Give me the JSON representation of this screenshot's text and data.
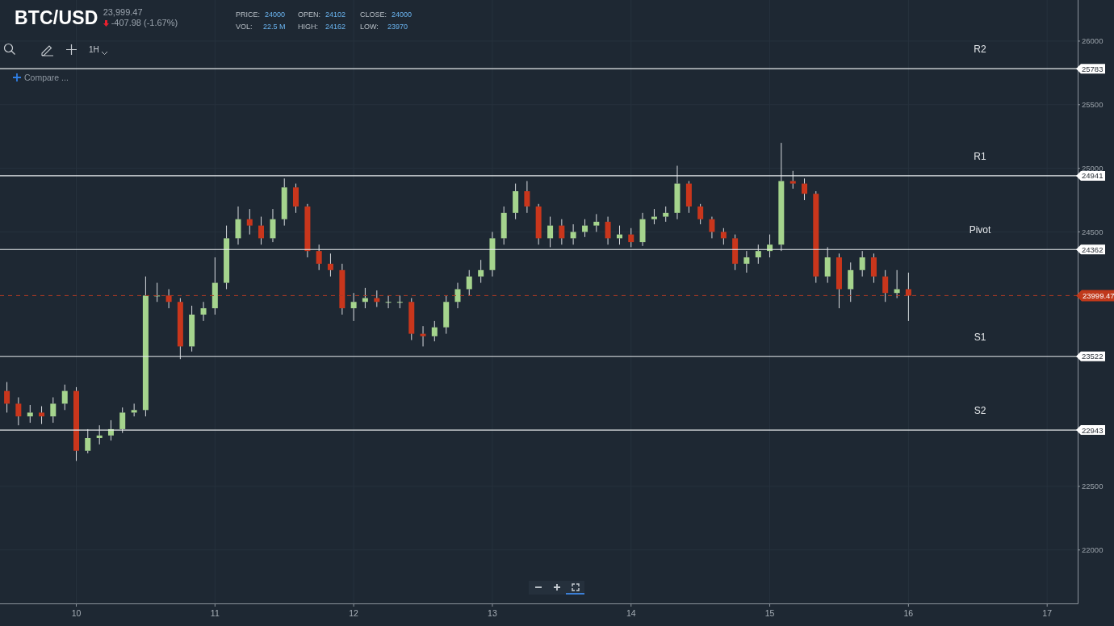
{
  "symbol": "BTC/USD",
  "quote": {
    "price": "23,999.47",
    "change": "-407.98 (-1.67%)",
    "down": true
  },
  "stats": [
    {
      "label": "PRICE:",
      "value": "24000"
    },
    {
      "label": "VOL:",
      "value": "22.5 M"
    },
    {
      "label": "OPEN:",
      "value": "24102"
    },
    {
      "label": "HIGH:",
      "value": "24162"
    },
    {
      "label": "CLOSE:",
      "value": "24000"
    },
    {
      "label": "LOW:",
      "value": "23970"
    }
  ],
  "toolbar": {
    "interval": "1H"
  },
  "compare": {
    "label": "Compare ..."
  },
  "levels": [
    {
      "label": "R2",
      "value": "25783"
    },
    {
      "label": "R1",
      "value": "24941"
    },
    {
      "label": "Pivot",
      "value": "24362"
    },
    {
      "label": "S1",
      "value": "23522"
    },
    {
      "label": "S2",
      "value": "22943"
    }
  ],
  "chart_data": {
    "type": "candlestick",
    "grid": true,
    "xlim": [
      9.45,
      17.22
    ],
    "ylim": [
      21580,
      26323
    ],
    "xticks": [
      10,
      11,
      12,
      13,
      14,
      15,
      16,
      17
    ],
    "yticks": [
      22000,
      22500,
      24500,
      25000,
      25500,
      26000
    ],
    "ref_lines": [
      {
        "axis": "y",
        "value": 23999.47,
        "label": "23999.47",
        "color": "#b03a24"
      }
    ],
    "x": [
      9.5,
      9.583,
      9.667,
      9.75,
      9.833,
      9.917,
      10,
      10.083,
      10.167,
      10.25,
      10.333,
      10.417,
      10.5,
      10.583,
      10.667,
      10.75,
      10.833,
      10.917,
      11,
      11.083,
      11.167,
      11.25,
      11.333,
      11.417,
      11.5,
      11.583,
      11.667,
      11.75,
      11.833,
      11.917,
      12,
      12.083,
      12.167,
      12.25,
      12.333,
      12.417,
      12.5,
      12.583,
      12.667,
      12.75,
      12.833,
      12.917,
      13,
      13.083,
      13.167,
      13.25,
      13.333,
      13.417,
      13.5,
      13.583,
      13.667,
      13.75,
      13.833,
      13.917,
      14,
      14.083,
      14.167,
      14.25,
      14.333,
      14.417,
      14.5,
      14.583,
      14.667,
      14.75,
      14.833,
      14.917,
      15,
      15.083,
      15.167,
      15.25,
      15.333,
      15.417,
      15.5,
      15.583,
      15.667,
      15.75,
      15.833,
      15.917,
      16
    ],
    "ohlc": [
      [
        23250,
        23320,
        23080,
        23150
      ],
      [
        23150,
        23200,
        22980,
        23050
      ],
      [
        23050,
        23140,
        23000,
        23080
      ],
      [
        23080,
        23130,
        22990,
        23050
      ],
      [
        23050,
        23200,
        23000,
        23150
      ],
      [
        23150,
        23300,
        23100,
        23250
      ],
      [
        23250,
        23280,
        22700,
        22780
      ],
      [
        22780,
        22950,
        22760,
        22880
      ],
      [
        22880,
        22980,
        22830,
        22900
      ],
      [
        22900,
        23020,
        22860,
        22950
      ],
      [
        22950,
        23120,
        22920,
        23080
      ],
      [
        23080,
        23150,
        23050,
        23100
      ],
      [
        23100,
        24150,
        23050,
        24000
      ],
      [
        24000,
        24100,
        23950,
        24000
      ],
      [
        24000,
        24050,
        23900,
        23950
      ],
      [
        23950,
        23980,
        23500,
        23600
      ],
      [
        23600,
        23920,
        23560,
        23850
      ],
      [
        23850,
        23950,
        23800,
        23900
      ],
      [
        23900,
        24300,
        23850,
        24100
      ],
      [
        24100,
        24550,
        24050,
        24450
      ],
      [
        24450,
        24700,
        24400,
        24600
      ],
      [
        24600,
        24680,
        24480,
        24550
      ],
      [
        24550,
        24620,
        24400,
        24450
      ],
      [
        24450,
        24680,
        24420,
        24600
      ],
      [
        24600,
        24920,
        24550,
        24850
      ],
      [
        24850,
        24880,
        24650,
        24700
      ],
      [
        24700,
        24720,
        24300,
        24350
      ],
      [
        24350,
        24400,
        24200,
        24250
      ],
      [
        24250,
        24330,
        24150,
        24200
      ],
      [
        24200,
        24250,
        23850,
        23900
      ],
      [
        23900,
        24020,
        23800,
        23950
      ],
      [
        23950,
        24060,
        23900,
        23980
      ],
      [
        23980,
        24040,
        23910,
        23950
      ],
      [
        23950,
        24000,
        23900,
        23950
      ],
      [
        23950,
        24000,
        23900,
        23950
      ],
      [
        23950,
        23980,
        23650,
        23700
      ],
      [
        23700,
        23760,
        23600,
        23680
      ],
      [
        23680,
        23800,
        23640,
        23750
      ],
      [
        23750,
        24000,
        23700,
        23950
      ],
      [
        23950,
        24100,
        23900,
        24050
      ],
      [
        24050,
        24200,
        24000,
        24150
      ],
      [
        24150,
        24280,
        24100,
        24200
      ],
      [
        24200,
        24500,
        24150,
        24450
      ],
      [
        24450,
        24700,
        24400,
        24650
      ],
      [
        24650,
        24880,
        24600,
        24820
      ],
      [
        24820,
        24900,
        24650,
        24700
      ],
      [
        24700,
        24720,
        24400,
        24450
      ],
      [
        24450,
        24620,
        24380,
        24550
      ],
      [
        24550,
        24600,
        24400,
        24450
      ],
      [
        24450,
        24560,
        24400,
        24500
      ],
      [
        24500,
        24600,
        24460,
        24550
      ],
      [
        24550,
        24640,
        24500,
        24580
      ],
      [
        24580,
        24620,
        24400,
        24450
      ],
      [
        24450,
        24550,
        24400,
        24480
      ],
      [
        24480,
        24530,
        24380,
        24420
      ],
      [
        24420,
        24650,
        24390,
        24600
      ],
      [
        24600,
        24680,
        24560,
        24620
      ],
      [
        24620,
        24700,
        24580,
        24650
      ],
      [
        24650,
        25020,
        24600,
        24880
      ],
      [
        24880,
        24900,
        24650,
        24700
      ],
      [
        24700,
        24720,
        24560,
        24600
      ],
      [
        24600,
        24620,
        24450,
        24500
      ],
      [
        24500,
        24530,
        24400,
        24450
      ],
      [
        24450,
        24480,
        24200,
        24250
      ],
      [
        24250,
        24350,
        24180,
        24300
      ],
      [
        24300,
        24400,
        24250,
        24350
      ],
      [
        24350,
        24480,
        24300,
        24400
      ],
      [
        24400,
        25200,
        24350,
        24900
      ],
      [
        24900,
        24980,
        24840,
        24880
      ],
      [
        24880,
        24920,
        24750,
        24800
      ],
      [
        24800,
        24820,
        24100,
        24150
      ],
      [
        24150,
        24380,
        24100,
        24300
      ],
      [
        24300,
        24330,
        23900,
        24050
      ],
      [
        24050,
        24260,
        23950,
        24200
      ],
      [
        24200,
        24350,
        24150,
        24300
      ],
      [
        24300,
        24330,
        24100,
        24150
      ],
      [
        24150,
        24200,
        23950,
        24020
      ],
      [
        24020,
        24200,
        23980,
        24050
      ],
      [
        24050,
        24180,
        23800,
        23999
      ]
    ]
  },
  "zoom_controls": [
    {
      "kind": "minus",
      "selected": false
    },
    {
      "kind": "plus",
      "selected": false
    },
    {
      "kind": "fullscreen",
      "selected": true
    }
  ]
}
